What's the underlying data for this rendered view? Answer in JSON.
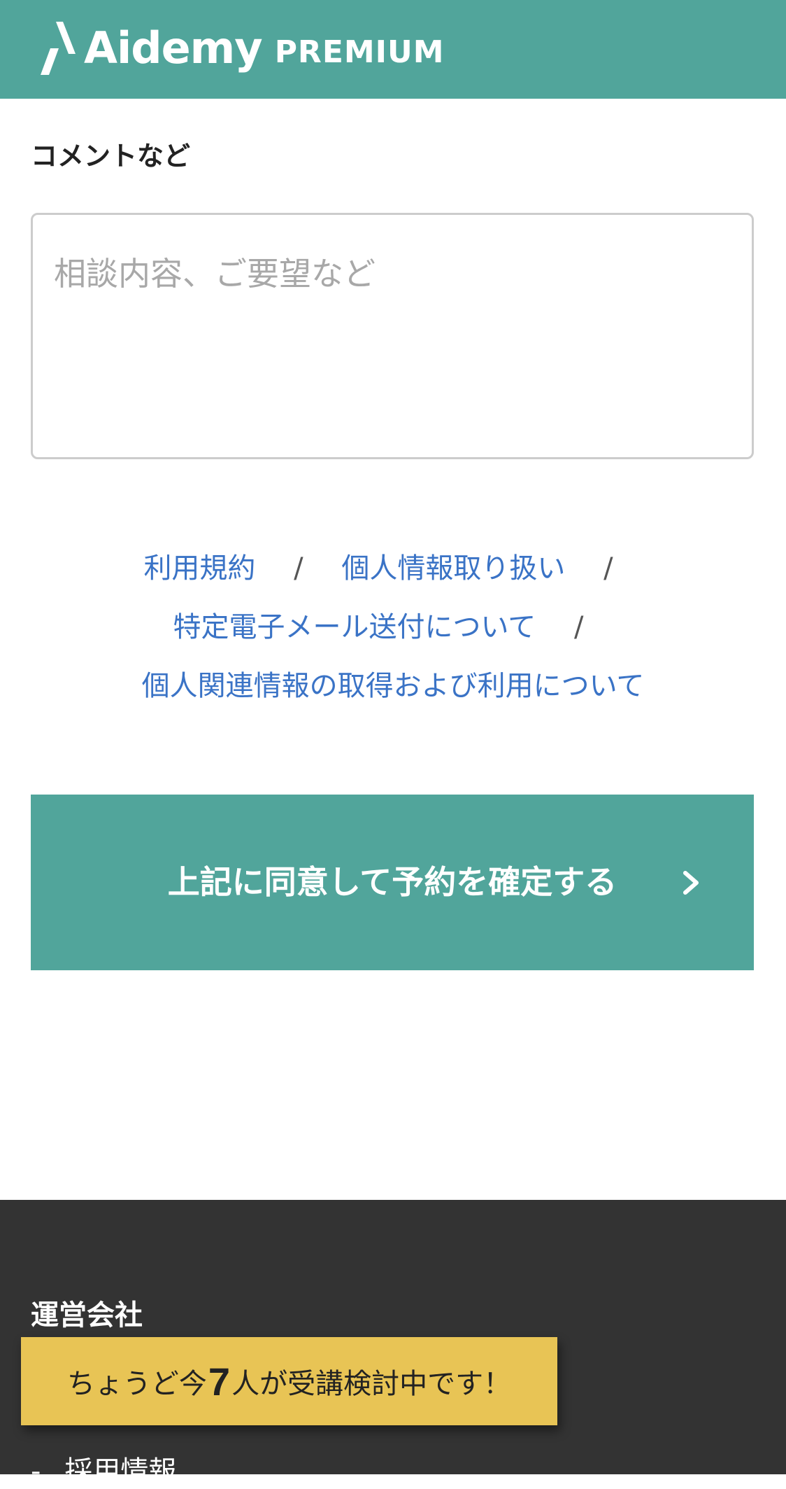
{
  "header": {
    "logo_word": "Aidemy",
    "logo_premium": "PREMIUM",
    "bg_color": "#51a59b"
  },
  "form": {
    "comment_label": "コメントなど",
    "comment_placeholder": "相談内容、ご要望など",
    "comment_value": ""
  },
  "links": {
    "terms": "利用規約",
    "privacy": "個人情報取り扱い",
    "email": "特定電子メール送付について",
    "personal_info": "個人関連情報の取得および利用について",
    "separator": "/"
  },
  "submit": {
    "label": "上記に同意して予約を確定する",
    "icon": "chevron-right-icon",
    "color": "#51a59b"
  },
  "footer": {
    "heading": "運営会社",
    "items": [
      {
        "dash": "-",
        "label": "採用情報"
      }
    ],
    "bg_color": "#333333"
  },
  "banner": {
    "prefix": "ちょうど今",
    "count": "7",
    "suffix": "人が受講検討中です！",
    "bg_color": "#e8c455"
  },
  "colors": {
    "link": "#3a73c6",
    "placeholder": "#a8a8a8"
  }
}
